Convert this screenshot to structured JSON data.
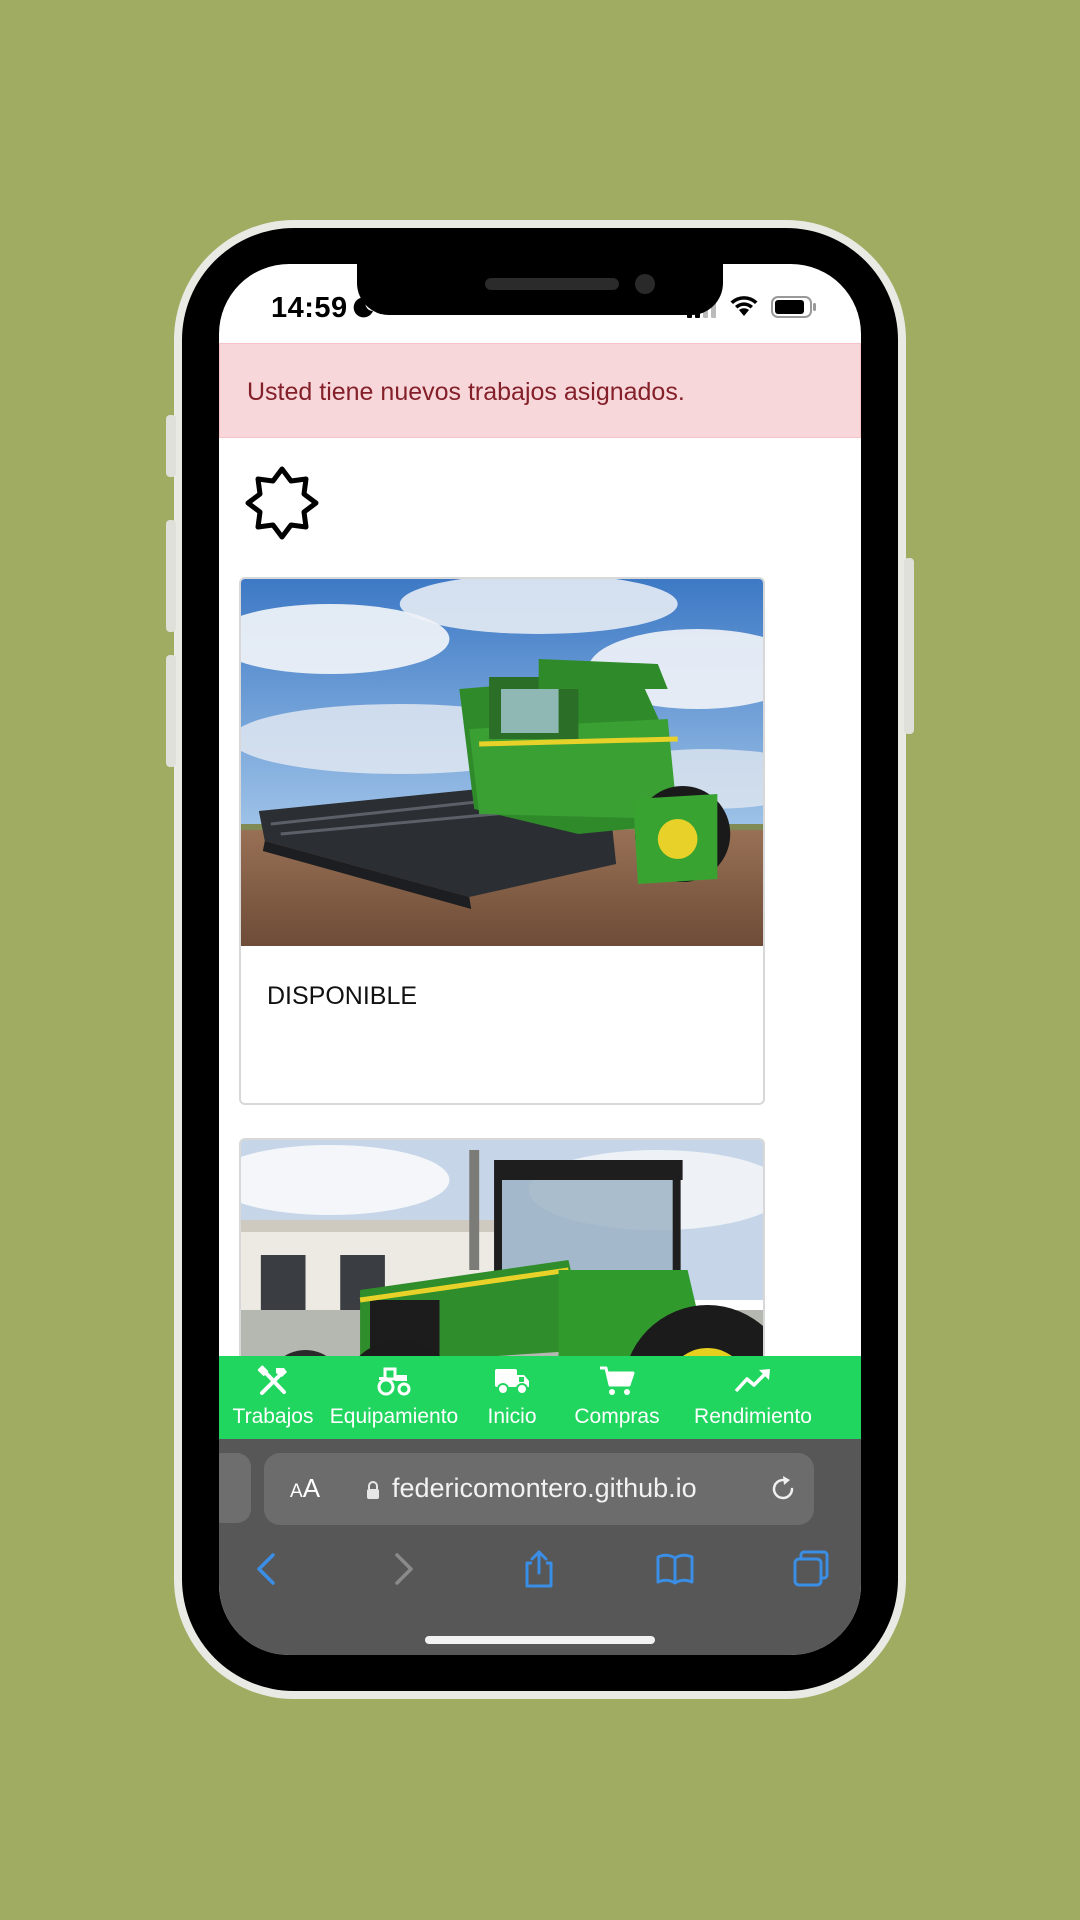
{
  "status_bar": {
    "time": "14:59"
  },
  "alert": {
    "message": "Usted tiene nuevos trabajos asignados."
  },
  "cards": [
    {
      "status": "DISPONIBLE",
      "image": "combine-harvester"
    },
    {
      "status": "",
      "image": "green-tractor"
    }
  ],
  "bottom_nav": {
    "items": [
      {
        "label": "Trabajos",
        "icon": "tools-icon"
      },
      {
        "label": "Equipamiento",
        "icon": "tractor-icon"
      },
      {
        "label": "Inicio",
        "icon": "truck-icon"
      },
      {
        "label": "Compras",
        "icon": "cart-icon"
      },
      {
        "label": "Rendimiento",
        "icon": "trending-up-icon"
      }
    ]
  },
  "browser": {
    "text_size_label_small": "A",
    "text_size_label_large": "A",
    "url": "federicomontero.github.io"
  },
  "colors": {
    "background": "#9fac62",
    "alert_bg": "#f8d7da",
    "alert_text": "#842029",
    "nav_bg": "#20d65f",
    "browser_bg": "#575757",
    "toolbar_icon": "#3a8ee6"
  }
}
